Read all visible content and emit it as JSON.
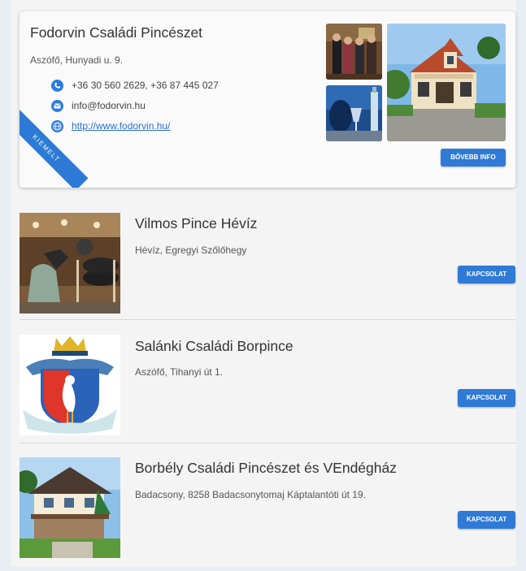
{
  "featured": {
    "title": "Fodorvin Családi Pincészet",
    "address": "Aszófő, Hunyadi u. 9.",
    "phone": "+36 30 560 2629, +36 87 445 027",
    "email": "info@fodorvin.hu",
    "website": "http://www.fodorvin.hu/",
    "ribbon": "KIEMELT",
    "more_button": "BŐVEBB INFO",
    "accent_color": "#2d7ad6"
  },
  "listings": [
    {
      "title": "Vilmos Pince Hévíz",
      "address": "Hévíz, Egregyi Szőlőhegy",
      "button": "KAPCSOLAT"
    },
    {
      "title": "Salánki Családi Borpince",
      "address": "Aszófő, Tihanyi út 1.",
      "button": "KAPCSOLAT"
    },
    {
      "title": "Borbély Családi Pincészet és VEndégház",
      "address": "Badacsony, 8258 Badacsonytomaj Káptalantóti út 19.",
      "button": "KAPCSOLAT"
    }
  ],
  "icons": {
    "phone": "phone-icon",
    "email": "envelope-icon",
    "web": "globe-icon"
  }
}
